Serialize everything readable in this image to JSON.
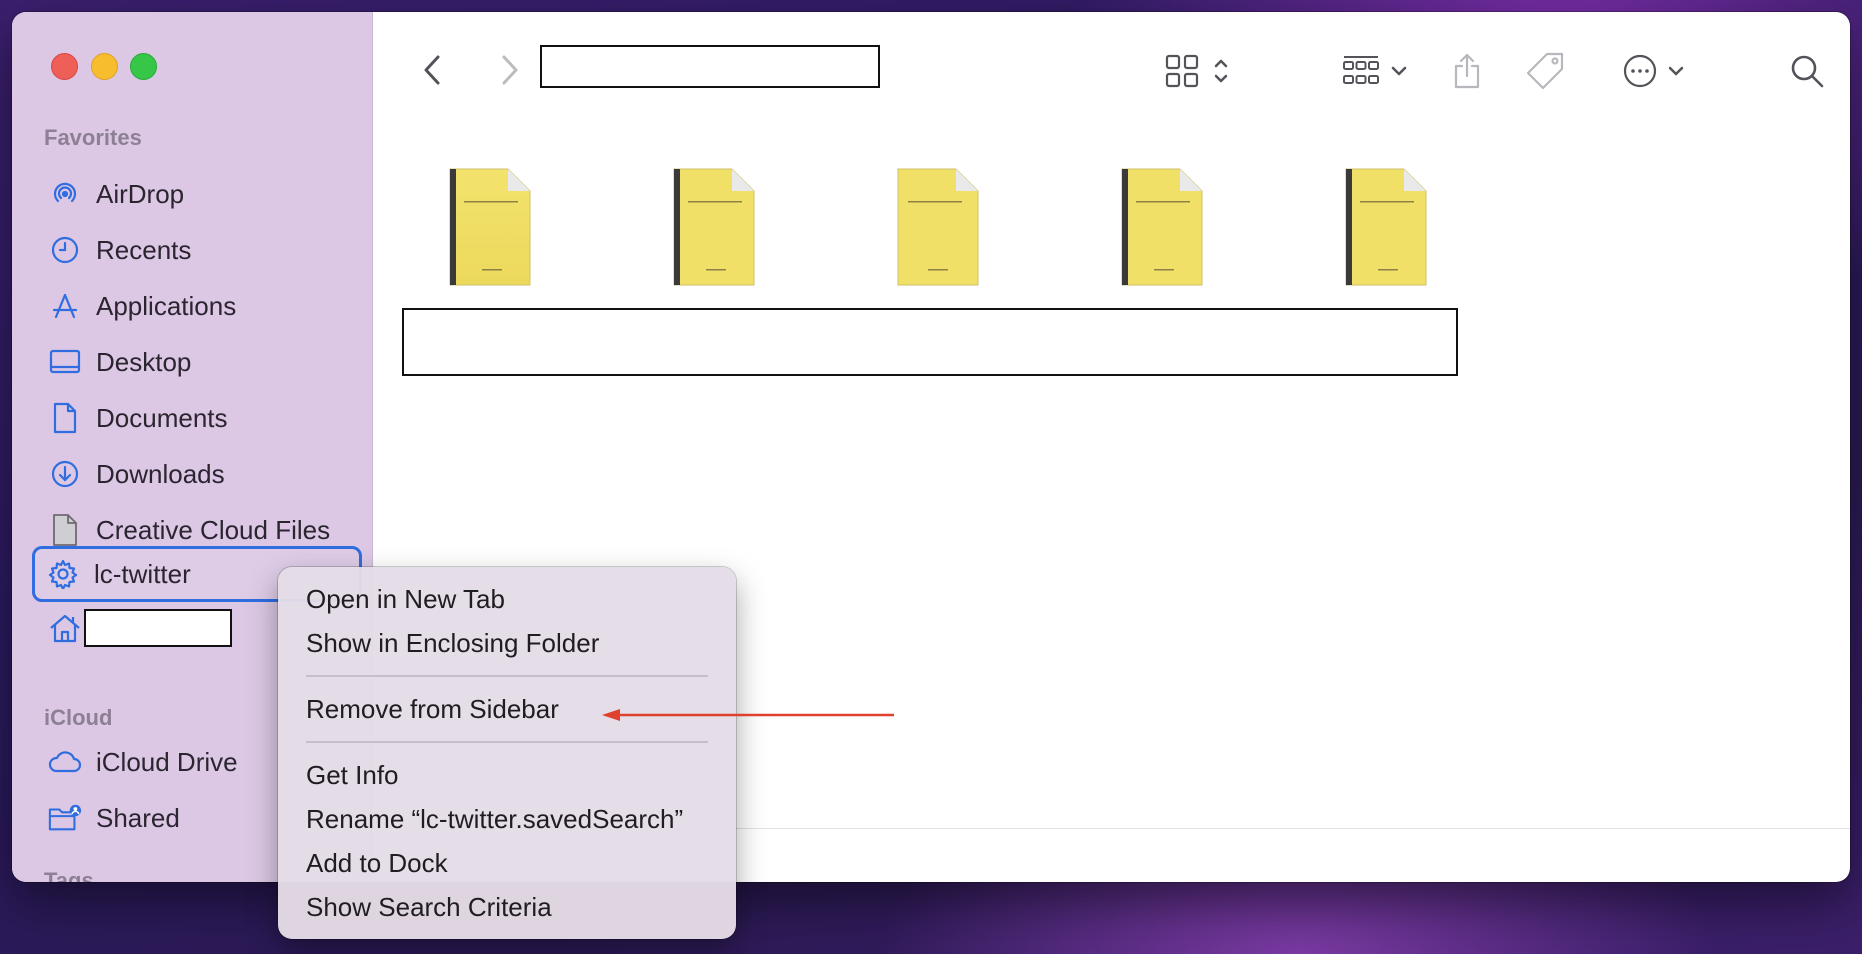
{
  "sidebar": {
    "favorites_heading": "Favorites",
    "icloud_heading": "iCloud",
    "tags_heading": "Tags",
    "items": [
      {
        "label": "AirDrop",
        "icon": "airdrop-icon"
      },
      {
        "label": "Recents",
        "icon": "clock-icon"
      },
      {
        "label": "Applications",
        "icon": "applications-icon"
      },
      {
        "label": "Desktop",
        "icon": "desktop-icon"
      },
      {
        "label": "Documents",
        "icon": "document-icon"
      },
      {
        "label": "Downloads",
        "icon": "download-icon"
      },
      {
        "label": "Creative Cloud Files",
        "icon": "file-icon"
      },
      {
        "label": "lc-twitter",
        "icon": "gear-icon"
      },
      {
        "label": "",
        "icon": "home-icon"
      }
    ],
    "icloud_items": [
      {
        "label": "iCloud Drive",
        "icon": "cloud-icon"
      },
      {
        "label": "Shared",
        "icon": "shared-folder-icon"
      }
    ]
  },
  "context_menu": {
    "open_new_tab": "Open in New Tab",
    "show_enclosing": "Show in Enclosing Folder",
    "remove_sidebar": "Remove from Sidebar",
    "get_info": "Get Info",
    "rename": "Rename “lc-twitter.savedSearch”",
    "add_dock": "Add to Dock",
    "show_criteria": "Show Search Criteria"
  },
  "colors": {
    "accent": "#2f6de0",
    "arrow": "#e0412f",
    "sidebar_bg": "#dcc8e4",
    "file_yellow": "#f2e26e"
  }
}
